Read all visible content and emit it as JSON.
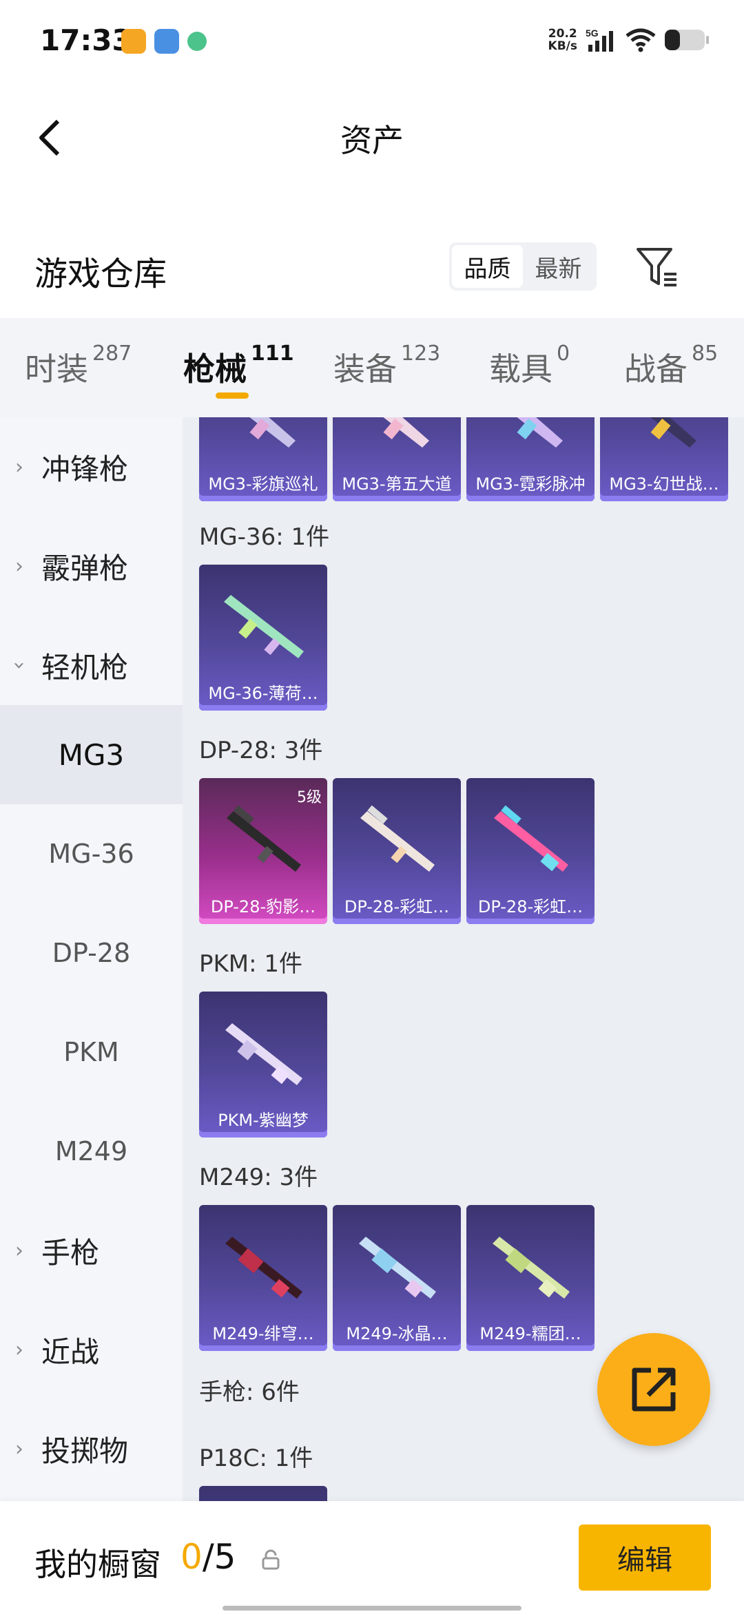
{
  "status": {
    "time": "17:33",
    "speed_value": "20.2",
    "speed_unit": "KB/s",
    "network": "5G"
  },
  "header": {
    "title": "资产"
  },
  "warehouse": {
    "title": "游戏仓库",
    "sort_quality": "品质",
    "sort_newest": "最新"
  },
  "categories": [
    {
      "label": "时装",
      "count": "287"
    },
    {
      "label": "枪械",
      "count": "111"
    },
    {
      "label": "装备",
      "count": "123"
    },
    {
      "label": "载具",
      "count": "0"
    },
    {
      "label": "战备",
      "count": "85"
    }
  ],
  "sidebar": {
    "smg": "冲锋枪",
    "shotgun": "霰弹枪",
    "lmg": "轻机枪",
    "mg3": "MG3",
    "mg36": "MG-36",
    "dp28": "DP-28",
    "pkm": "PKM",
    "m249": "M249",
    "pistol": "手枪",
    "melee": "近战",
    "throwable": "投掷物"
  },
  "sections": {
    "mg36": "MG-36: 1件",
    "dp28": "DP-28: 3件",
    "pkm": "PKM: 1件",
    "m249": "M249: 3件",
    "pistol": "手枪: 6件",
    "p18c": "P18C: 1件"
  },
  "items": {
    "mg3_1": "MG3-彩旗巡礼",
    "mg3_2": "MG3-第五大道",
    "mg3_3": "MG3-霓彩脉冲",
    "mg3_4": "MG3-幻世战…",
    "mg36_1": "MG-36-薄荷…",
    "dp28_1": "DP-28-豹影…",
    "dp28_1_level": "5级",
    "dp28_2": "DP-28-彩虹…",
    "dp28_3": "DP-28-彩虹…",
    "pkm_1": "PKM-紫幽梦",
    "m249_1": "M249-绯穹…",
    "m249_2": "M249-冰晶…",
    "m249_3": "M249-糯团…"
  },
  "showcase": {
    "title": "我的橱窗",
    "used": "0",
    "separator": "/",
    "total": "5",
    "edit_label": "编辑"
  },
  "colors": {
    "accent": "#f4a900",
    "card_purple": "#52489a",
    "card_pink": "#9a2f8c"
  }
}
